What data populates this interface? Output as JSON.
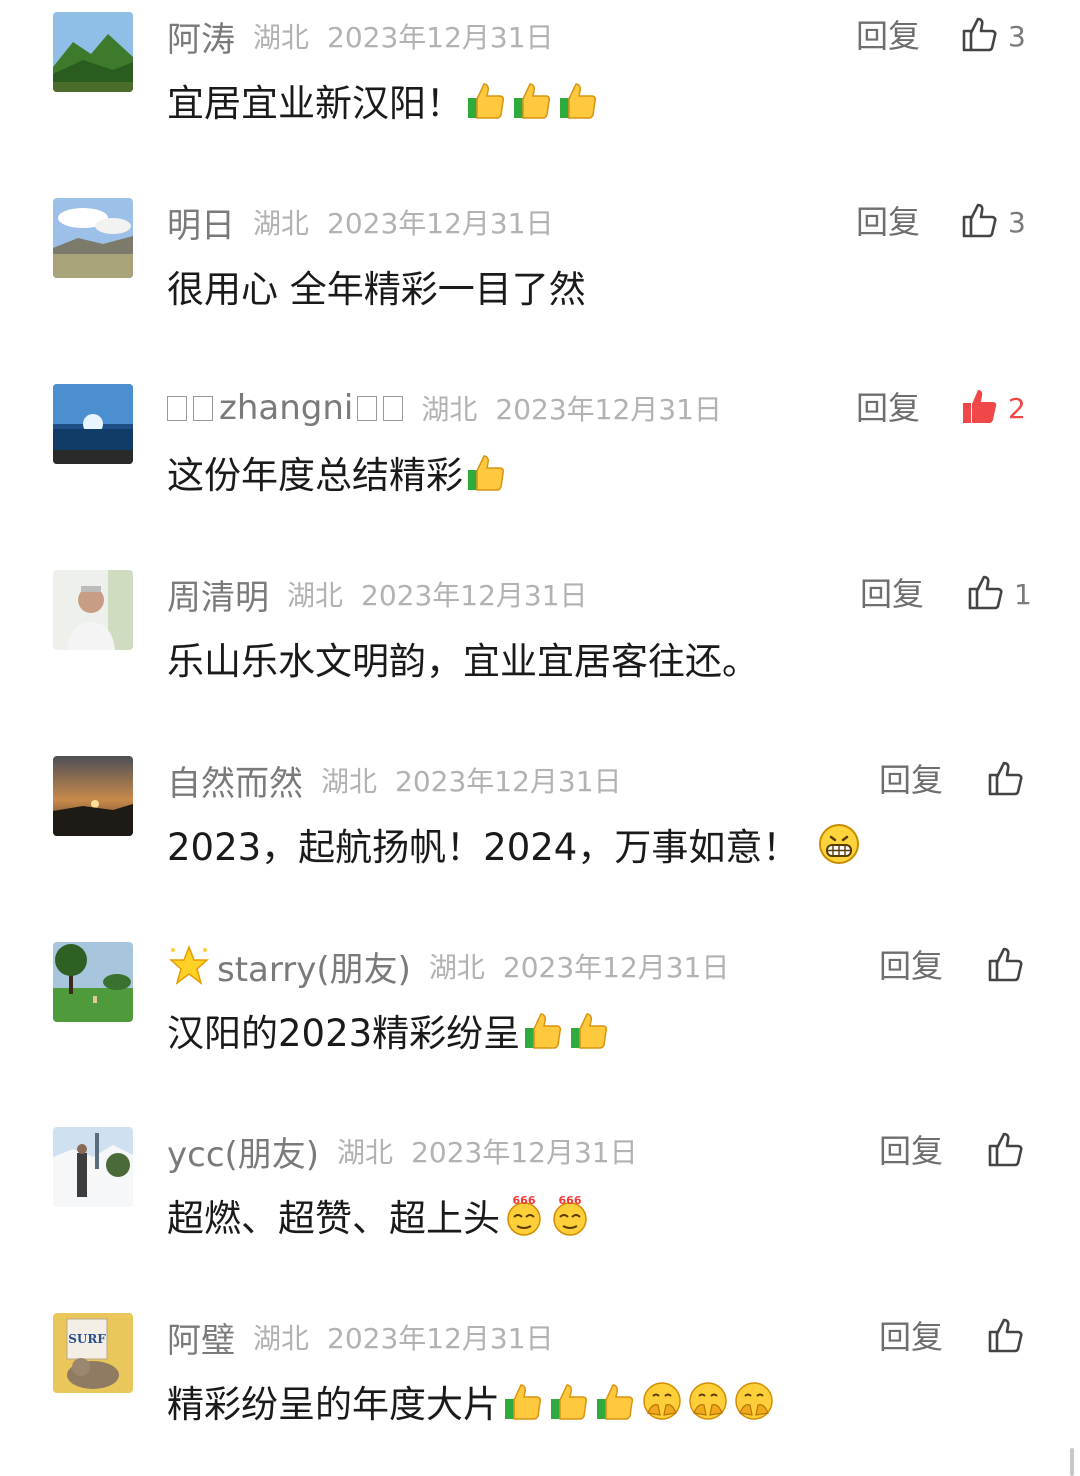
{
  "labels": {
    "reply": "回复"
  },
  "colors": {
    "like_active": "#f04848",
    "meta_gray": "#b2b2b2",
    "name_gray": "#7a7a7a"
  },
  "comments": [
    {
      "name": "阿涛",
      "location": "湖北",
      "date": "2023年12月31日",
      "text": "宜居宜业新汉阳！",
      "likes": "3",
      "liked": false,
      "emojis": [
        "thumbs-up",
        "thumbs-up",
        "thumbs-up"
      ],
      "avatar": "mountain-landscape"
    },
    {
      "name": "明日",
      "location": "湖北",
      "date": "2023年12月31日",
      "text": "很用心 全年精彩一目了然",
      "likes": "3",
      "liked": false,
      "emojis": [],
      "avatar": "grassland-sky"
    },
    {
      "name_prefix": "□□",
      "name": "zhangni",
      "name_suffix": "□□",
      "location": "湖北",
      "date": "2023年12月31日",
      "text": "这份年度总结精彩",
      "likes": "2",
      "liked": true,
      "emojis": [
        "thumbs-up"
      ],
      "avatar": "blue-sea"
    },
    {
      "name": "周清明",
      "location": "湖北",
      "date": "2023年12月31日",
      "text": "乐山乐水文明韵，宜业宜居客往还。",
      "likes": "1",
      "liked": false,
      "emojis": [],
      "avatar": "person-portrait"
    },
    {
      "name": "自然而然",
      "location": "湖北",
      "date": "2023年12月31日",
      "text": "2023，起航扬帆！2024，万事如意！",
      "likes": "",
      "liked": false,
      "emojis": [
        "grinning-face"
      ],
      "avatar": "sunset"
    },
    {
      "name": "starry(朋友)",
      "location": "湖北",
      "date": "2023年12月31日",
      "text": "汉阳的2023精彩纷呈",
      "likes": "",
      "liked": false,
      "emojis": [
        "thumbs-up",
        "thumbs-up"
      ],
      "avatar": "park-tree",
      "name_icon": "sparkle-star"
    },
    {
      "name": "ycc(朋友)",
      "location": "湖北",
      "date": "2023年12月31日",
      "text": "超燃、超赞、超上头",
      "likes": "",
      "liked": false,
      "emojis": [
        "666-face",
        "666-face"
      ],
      "avatar": "snow-scene"
    },
    {
      "name": "阿璧",
      "location": "湖北",
      "date": "2023年12月31日",
      "text": "精彩纷呈的年度大片",
      "likes": "",
      "liked": false,
      "emojis": [
        "thumbs-up",
        "thumbs-up",
        "thumbs-up",
        "salute-face",
        "salute-face",
        "salute-face"
      ],
      "avatar": "cat-surf"
    }
  ]
}
